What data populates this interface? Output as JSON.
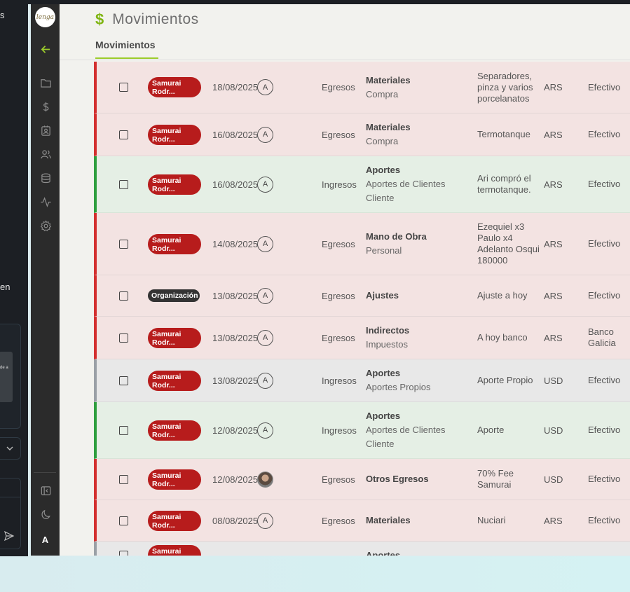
{
  "background": {
    "left_fragments": [
      "s",
      "en"
    ],
    "thumb_text": "de a"
  },
  "sidebar": {
    "logo_text": "lenga",
    "user_initial": "A"
  },
  "header": {
    "title": "Movimientos",
    "tab": "Movimientos"
  },
  "rows": [
    {
      "kind": "egreso",
      "badge": "Samurai Rodr...",
      "date": "18/08/2025",
      "avatar": "A",
      "type": "Egresos",
      "cat": "Materiales",
      "sub": [
        "Compra"
      ],
      "desc": "Separadores, pinza y varios porcelanatos",
      "currency": "ARS",
      "payment": "Efectivo"
    },
    {
      "kind": "egreso",
      "badge": "Samurai Rodr...",
      "date": "16/08/2025",
      "avatar": "A",
      "type": "Egresos",
      "cat": "Materiales",
      "sub": [
        "Compra"
      ],
      "desc": "Termotanque",
      "currency": "ARS",
      "payment": "Efectivo"
    },
    {
      "kind": "ingreso",
      "badge": "Samurai Rodr...",
      "date": "16/08/2025",
      "avatar": "A",
      "type": "Ingresos",
      "cat": "Aportes",
      "sub": [
        "Aportes de Clientes",
        "Cliente"
      ],
      "desc": "Ari compró el termotanque.",
      "currency": "ARS",
      "payment": "Efectivo"
    },
    {
      "kind": "egreso",
      "badge": "Samurai Rodr...",
      "date": "14/08/2025",
      "avatar": "A",
      "type": "Egresos",
      "cat": "Mano de Obra",
      "sub": [
        "Personal"
      ],
      "desc": "Ezequiel x3 Paulo x4 Adelanto Osqui 180000",
      "currency": "ARS",
      "payment": "Efectivo"
    },
    {
      "kind": "egreso",
      "badge": "Organización",
      "org": true,
      "date": "13/08/2025",
      "avatar": "A",
      "type": "Egresos",
      "cat": "Ajustes",
      "sub": [],
      "desc": "Ajuste a hoy",
      "currency": "ARS",
      "payment": "Efectivo"
    },
    {
      "kind": "egreso",
      "badge": "Samurai Rodr...",
      "date": "13/08/2025",
      "avatar": "A",
      "type": "Egresos",
      "cat": "Indirectos",
      "sub": [
        "Impuestos"
      ],
      "desc": "A hoy banco",
      "currency": "ARS",
      "payment": "Banco Galicia"
    },
    {
      "kind": "neutral",
      "badge": "Samurai Rodr...",
      "date": "13/08/2025",
      "avatar": "A",
      "type": "Ingresos",
      "cat": "Aportes",
      "sub": [
        "Aportes Propios"
      ],
      "desc": "Aporte Propio",
      "currency": "USD",
      "payment": "Efectivo"
    },
    {
      "kind": "ingreso",
      "badge": "Samurai Rodr...",
      "date": "12/08/2025",
      "avatar": "A",
      "type": "Ingresos",
      "cat": "Aportes",
      "sub": [
        "Aportes de Clientes",
        "Cliente"
      ],
      "desc": "Aporte",
      "currency": "USD",
      "payment": "Efectivo"
    },
    {
      "kind": "egreso",
      "badge": "Samurai Rodr...",
      "date": "12/08/2025",
      "avatar": "",
      "photo": true,
      "type": "Egresos",
      "cat": "Otros Egresos",
      "sub": [],
      "desc": "70% Fee Samurai",
      "currency": "USD",
      "payment": "Efectivo"
    },
    {
      "kind": "egreso",
      "badge": "Samurai Rodr...",
      "date": "08/08/2025",
      "avatar": "A",
      "type": "Egresos",
      "cat": "Materiales",
      "sub": [],
      "desc": "Nuciari",
      "currency": "ARS",
      "payment": "Efectivo"
    },
    {
      "kind": "neutral",
      "badge": "Samurai Rodr...",
      "date": "",
      "avatar": "",
      "type": "",
      "cat": "Aportes",
      "sub": [],
      "desc": "",
      "currency": "",
      "payment": ""
    }
  ]
}
